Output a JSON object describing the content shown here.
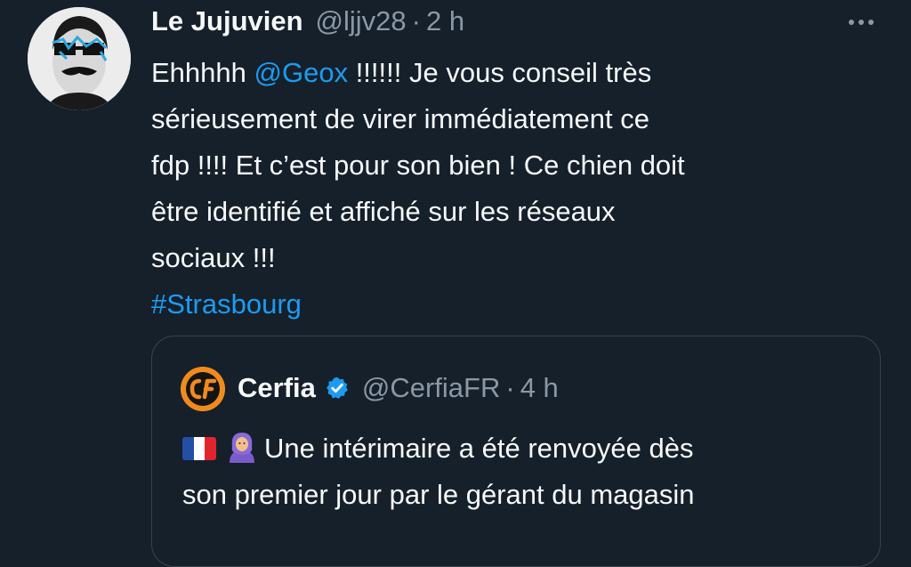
{
  "tweet": {
    "display_name": "Le Jujuvien",
    "handle": "@ljjv28",
    "separator": "·",
    "time": "2 h",
    "lines": [
      {
        "prefix": "Ehhhhh ",
        "mention": "@Geox",
        "suffix": " !!!!!! Je vous conseil très"
      },
      {
        "text": "sérieusement de virer immédiatement ce"
      },
      {
        "text": "fdp !!!! Et c’est pour son bien ! Ce chien doit"
      },
      {
        "text": "être identifié et affiché sur les réseaux"
      },
      {
        "text": "sociaux !!!"
      }
    ],
    "hashtag": "#Strasbourg"
  },
  "quote": {
    "display_name": "Cerfia",
    "handle": "@CerfiaFR",
    "separator": "·",
    "time": "4 h",
    "line1": "Une intérimaire a été renvoyée dès",
    "line2": "son premier jour par le gérant du magasin",
    "emojis": [
      "french-flag",
      "person-with-headscarf"
    ]
  },
  "colors": {
    "background": "#15202b",
    "text": "#f7f9f9",
    "secondary": "#8b98a5",
    "link": "#1d9bf0",
    "border": "#38444d",
    "cerfia_orange": "#f18a1d"
  }
}
